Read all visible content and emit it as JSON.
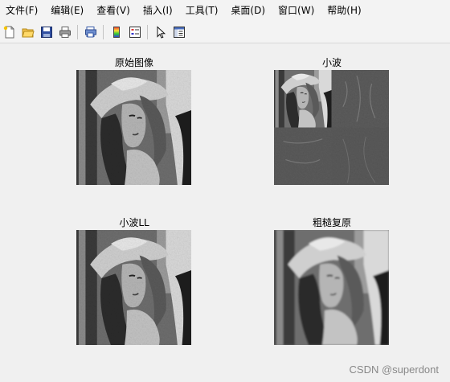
{
  "menu": [
    {
      "label": "文件(F)"
    },
    {
      "label": "编辑(E)"
    },
    {
      "label": "查看(V)"
    },
    {
      "label": "插入(I)"
    },
    {
      "label": "工具(T)"
    },
    {
      "label": "桌面(D)"
    },
    {
      "label": "窗口(W)"
    },
    {
      "label": "帮助(H)"
    }
  ],
  "toolbar": {
    "icons": [
      "new-file-icon",
      "open-folder-icon",
      "save-icon",
      "print-icon",
      "print-preview-icon",
      "colorbar-icon",
      "legend-icon",
      "pointer-icon",
      "property-editor-icon"
    ]
  },
  "panels": {
    "original": {
      "title": "原始图像"
    },
    "wavelet": {
      "title": "小波"
    },
    "wavelet_ll": {
      "title": "小波LL"
    },
    "rough_restore": {
      "title": "粗糙复原"
    }
  },
  "watermark": "CSDN @superdont"
}
